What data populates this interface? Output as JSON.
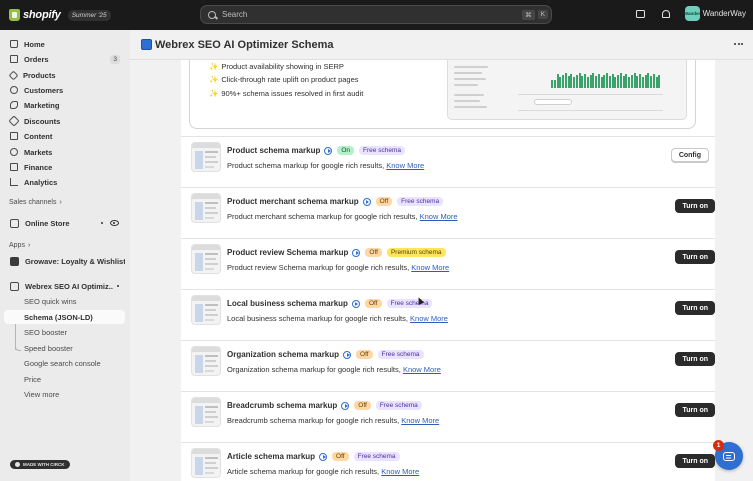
{
  "topbar": {
    "logo_text": "shopify",
    "edition_badge": "Summer '25",
    "search_placeholder": "Search",
    "shortcut_keys": [
      "⌘",
      "K"
    ],
    "avatar_text": "Wander",
    "store_name": "WanderWay"
  },
  "sidebar": {
    "nav": [
      {
        "label": "Home",
        "icon": "home-icon"
      },
      {
        "label": "Orders",
        "icon": "orders-icon",
        "count": "3"
      },
      {
        "label": "Products",
        "icon": "products-icon"
      },
      {
        "label": "Customers",
        "icon": "customers-icon"
      },
      {
        "label": "Marketing",
        "icon": "marketing-icon"
      },
      {
        "label": "Discounts",
        "icon": "discounts-icon"
      },
      {
        "label": "Content",
        "icon": "content-icon"
      },
      {
        "label": "Markets",
        "icon": "markets-icon"
      },
      {
        "label": "Finance",
        "icon": "finance-icon"
      },
      {
        "label": "Analytics",
        "icon": "analytics-icon"
      }
    ],
    "sales_channels_label": "Sales channels",
    "online_store_label": "Online Store",
    "apps_label": "Apps",
    "apps": [
      {
        "label": "Growave: Loyalty & Wishlist"
      },
      {
        "label": "Webrex SEO AI Optimiz..."
      }
    ],
    "sub_items": [
      {
        "label": "SEO quick wins"
      },
      {
        "label": "Schema (JSON-LD)"
      },
      {
        "label": "SEO booster"
      },
      {
        "label": "Speed booster"
      },
      {
        "label": "Google search console"
      },
      {
        "label": "Price"
      },
      {
        "label": "View more"
      }
    ],
    "made_badge": "MADE WITH CIRCK"
  },
  "page": {
    "title": "Webrex SEO AI Optimizer Schema",
    "benefits": [
      "Product availability showing in SERP",
      "Click-through rate uplift on product pages",
      "90%+ schema issues resolved in first audit"
    ]
  },
  "schemas": [
    {
      "name": "Product schema markup",
      "status": "On",
      "tier": "Free schema",
      "desc": "Product schema markup for google rich results,",
      "link": "Know More",
      "action": "Config"
    },
    {
      "name": "Product merchant schema markup",
      "status": "Off",
      "tier": "Free schema",
      "desc": "Product merchant schema markup for google rich results,",
      "link": "Know More",
      "action": "Turn on"
    },
    {
      "name": "Product review Schema markup",
      "status": "Off",
      "tier": "Premium schema",
      "desc": "Product review Schema markup for google rich results,",
      "link": "Know More",
      "action": "Turn on"
    },
    {
      "name": "Local business schema markup",
      "status": "Off",
      "tier": "Free schema",
      "desc": "Local business schema markup for google rich results,",
      "link": "Know More",
      "action": "Turn on"
    },
    {
      "name": "Organization schema markup",
      "status": "Off",
      "tier": "Free schema",
      "desc": "Organization schema markup for google rich results,",
      "link": "Know More",
      "action": "Turn on"
    },
    {
      "name": "Breadcrumb schema markup",
      "status": "Off",
      "tier": "Free schema",
      "desc": "Breadcrumb schema markup for google rich results,",
      "link": "Know More",
      "action": "Turn on"
    },
    {
      "name": "Article schema markup",
      "status": "Off",
      "tier": "Free schema",
      "desc": "Article schema markup for google rich results,",
      "link": "Know More",
      "action": "Turn on"
    }
  ],
  "chat": {
    "unread_count": "1"
  },
  "colors": {
    "topbar": "#1a1a1a",
    "accent_blue": "#2f6fd1",
    "on_badge": "#b4f0c8",
    "off_badge": "#ffd6a4",
    "free_badge": "#e9e3ff",
    "premium_badge": "#ffe45c",
    "dark_button": "#2b2b2b"
  }
}
